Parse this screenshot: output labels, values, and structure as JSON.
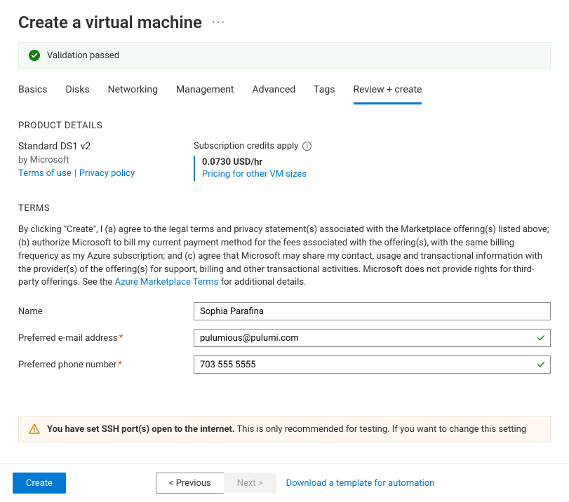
{
  "header": {
    "title": "Create a virtual machine"
  },
  "banner": {
    "text": "Validation passed"
  },
  "tabs": [
    {
      "label": "Basics"
    },
    {
      "label": "Disks"
    },
    {
      "label": "Networking"
    },
    {
      "label": "Management"
    },
    {
      "label": "Advanced"
    },
    {
      "label": "Tags"
    },
    {
      "label": "Review + create",
      "active": true
    }
  ],
  "product": {
    "section_title": "PRODUCT DETAILS",
    "name": "Standard DS1 v2",
    "by": "by Microsoft",
    "terms_link": "Terms of use",
    "privacy_link": "Privacy policy",
    "credits_label": "Subscription credits apply",
    "price": "0.0730 USD/hr",
    "pricing_link": "Pricing for other VM sizes"
  },
  "terms": {
    "section_title": "TERMS",
    "text_a": "By clicking \"Create\", I (a) agree to the legal terms and privacy statement(s) associated with the Marketplace offering(s) listed above; (b) authorize Microsoft to bill my current payment method for the fees associated with the offering(s), with the same billing frequency as my Azure subscription; and (c) agree that Microsoft may share my contact, usage and transactional information with the provider(s) of the offering(s) for support, billing and other transactional activities. Microsoft does not provide rights for third-party offerings. See the ",
    "link": "Azure Marketplace Terms",
    "text_b": " for additional details."
  },
  "form": {
    "name_label": "Name",
    "name_value": "Sophia Parafina",
    "email_label": "Preferred e-mail address",
    "email_value": "pulumious@pulumi.com",
    "phone_label": "Preferred phone number",
    "phone_value": "703 555 5555"
  },
  "warning": {
    "bold": "You have set SSH port(s) open to the internet.",
    "rest": " This is only recommended for testing. If you want to change this setting"
  },
  "footer": {
    "create": "Create",
    "prev": "< Previous",
    "next": "Next >",
    "download": "Download a template for automation"
  }
}
